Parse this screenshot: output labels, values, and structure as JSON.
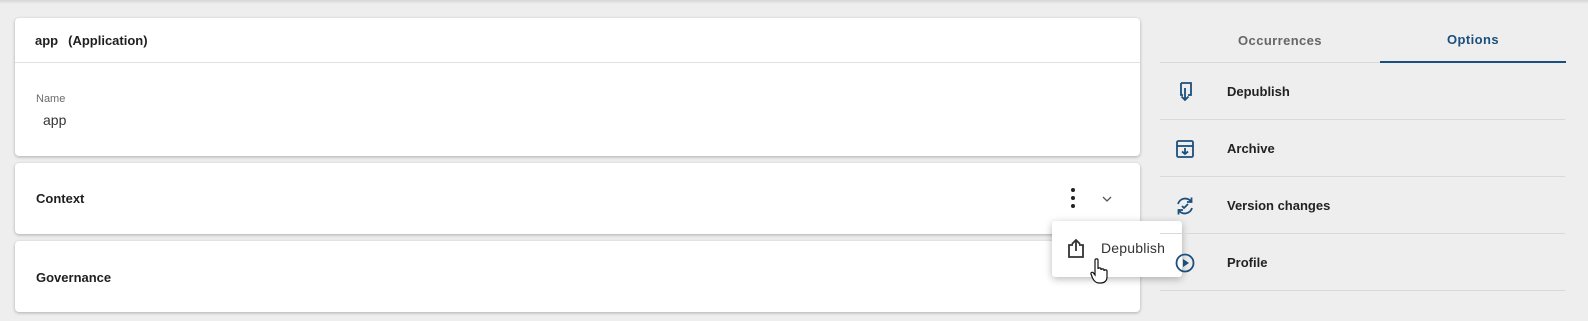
{
  "header_card": {
    "name": "app",
    "type": "(Application)"
  },
  "name_field": {
    "label": "Name",
    "value": "app"
  },
  "panels": {
    "context": "Context",
    "governance": "Governance"
  },
  "popup_menu": {
    "item_label": "Depublish",
    "icon": "share-upload-icon"
  },
  "tabs": [
    {
      "label": "Occurrences",
      "active": false
    },
    {
      "label": "Options",
      "active": true
    }
  ],
  "options": [
    {
      "label": "Depublish",
      "icon": "depublish-icon"
    },
    {
      "label": "Archive",
      "icon": "archive-icon"
    },
    {
      "label": "Version changes",
      "icon": "version-sync-icon"
    },
    {
      "label": "Profile",
      "icon": "profile-play-icon"
    }
  ],
  "colors": {
    "accent": "#1b4f7d",
    "background": "#eeeeee"
  }
}
